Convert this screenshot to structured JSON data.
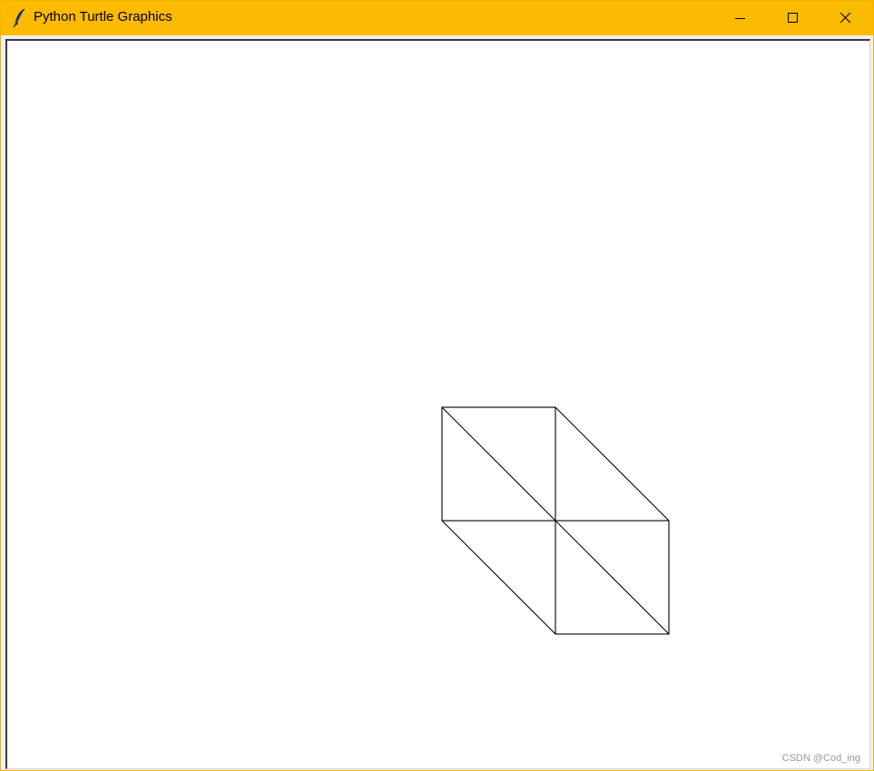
{
  "window": {
    "title": "Python Turtle Graphics",
    "icon": "feather-icon",
    "controls": [
      "minimize-icon",
      "maximize-icon",
      "close-icon"
    ],
    "titlebar_color": "#fdbb00"
  },
  "canvas": {
    "background": "#ffffff",
    "stroke_color": "#000000",
    "shapes": [
      {
        "name": "upper-left-square",
        "kind": "square with diagonal"
      },
      {
        "name": "lower-right-square",
        "kind": "square with diagonal"
      },
      {
        "name": "upper-right-slant",
        "kind": "slanted edge"
      },
      {
        "name": "lower-left-slant",
        "kind": "slanted edge"
      }
    ]
  },
  "watermark": "CSDN @Cod_ing"
}
